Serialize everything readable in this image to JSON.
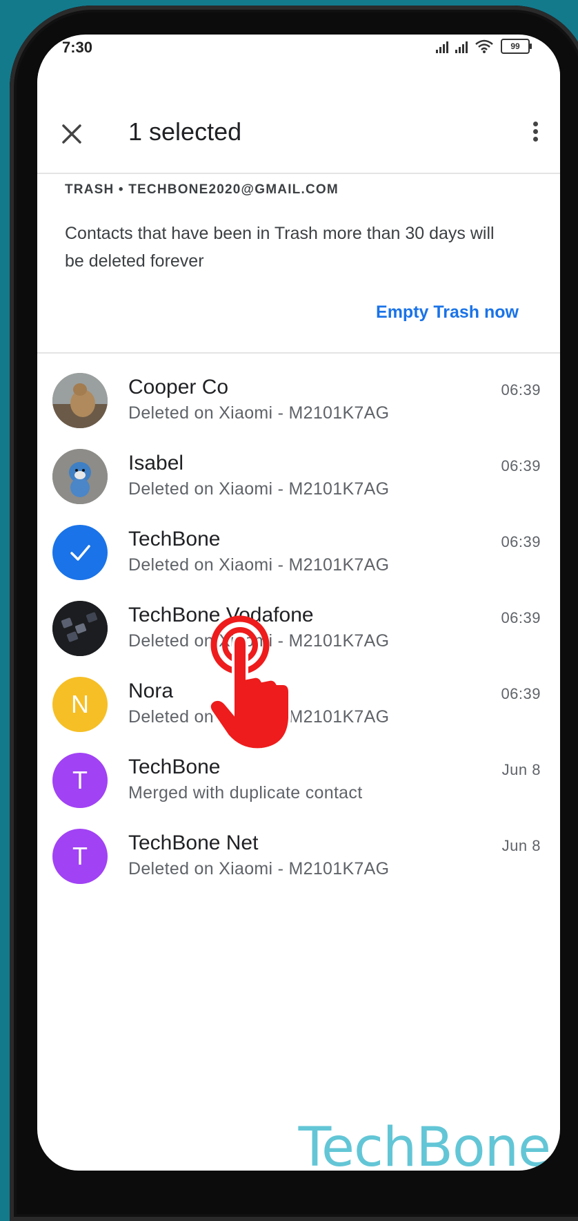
{
  "status": {
    "time": "7:30",
    "battery": "99"
  },
  "appbar": {
    "title": "1 selected"
  },
  "trash": {
    "header": "TRASH • TECHBONE2020@GMAIL.COM",
    "description": "Contacts that have been in Trash more than 30 days will be deleted forever",
    "action": "Empty Trash now"
  },
  "contacts": [
    {
      "name": "Cooper Co",
      "detail": "Deleted on Xiaomi - M2101K7AG",
      "time": "06:39",
      "avatar": "dog-photo",
      "selected": false
    },
    {
      "name": "Isabel",
      "detail": "Deleted on Xiaomi - M2101K7AG",
      "time": "06:39",
      "avatar": "plush-photo",
      "selected": false
    },
    {
      "name": "TechBone",
      "detail": "Deleted on Xiaomi - M2101K7AG",
      "time": "06:39",
      "avatar": "check-icon",
      "selected": true,
      "color": "#1a73e8"
    },
    {
      "name": "TechBone Vodafone",
      "detail": "Deleted on Xiaomi - M2101K7AG",
      "time": "06:39",
      "avatar": "keyboard-photo",
      "selected": false
    },
    {
      "name": "Nora",
      "detail": "Deleted on Xiaomi - M2101K7AG",
      "time": "06:39",
      "avatar": "N",
      "selected": false,
      "color": "#f6bf26"
    },
    {
      "name": "TechBone",
      "detail": "Merged with duplicate contact",
      "time": "Jun 8",
      "avatar": "T",
      "selected": false,
      "color": "#a142f4"
    },
    {
      "name": "TechBone Net",
      "detail": "Deleted on Xiaomi - M2101K7AG",
      "time": "Jun 8",
      "avatar": "T",
      "selected": false,
      "color": "#a142f4"
    }
  ],
  "watermark": "TechBone",
  "colors": {
    "accent": "#1a73e8",
    "background": "#137a8c",
    "tap_indicator": "#ee1c1c"
  }
}
